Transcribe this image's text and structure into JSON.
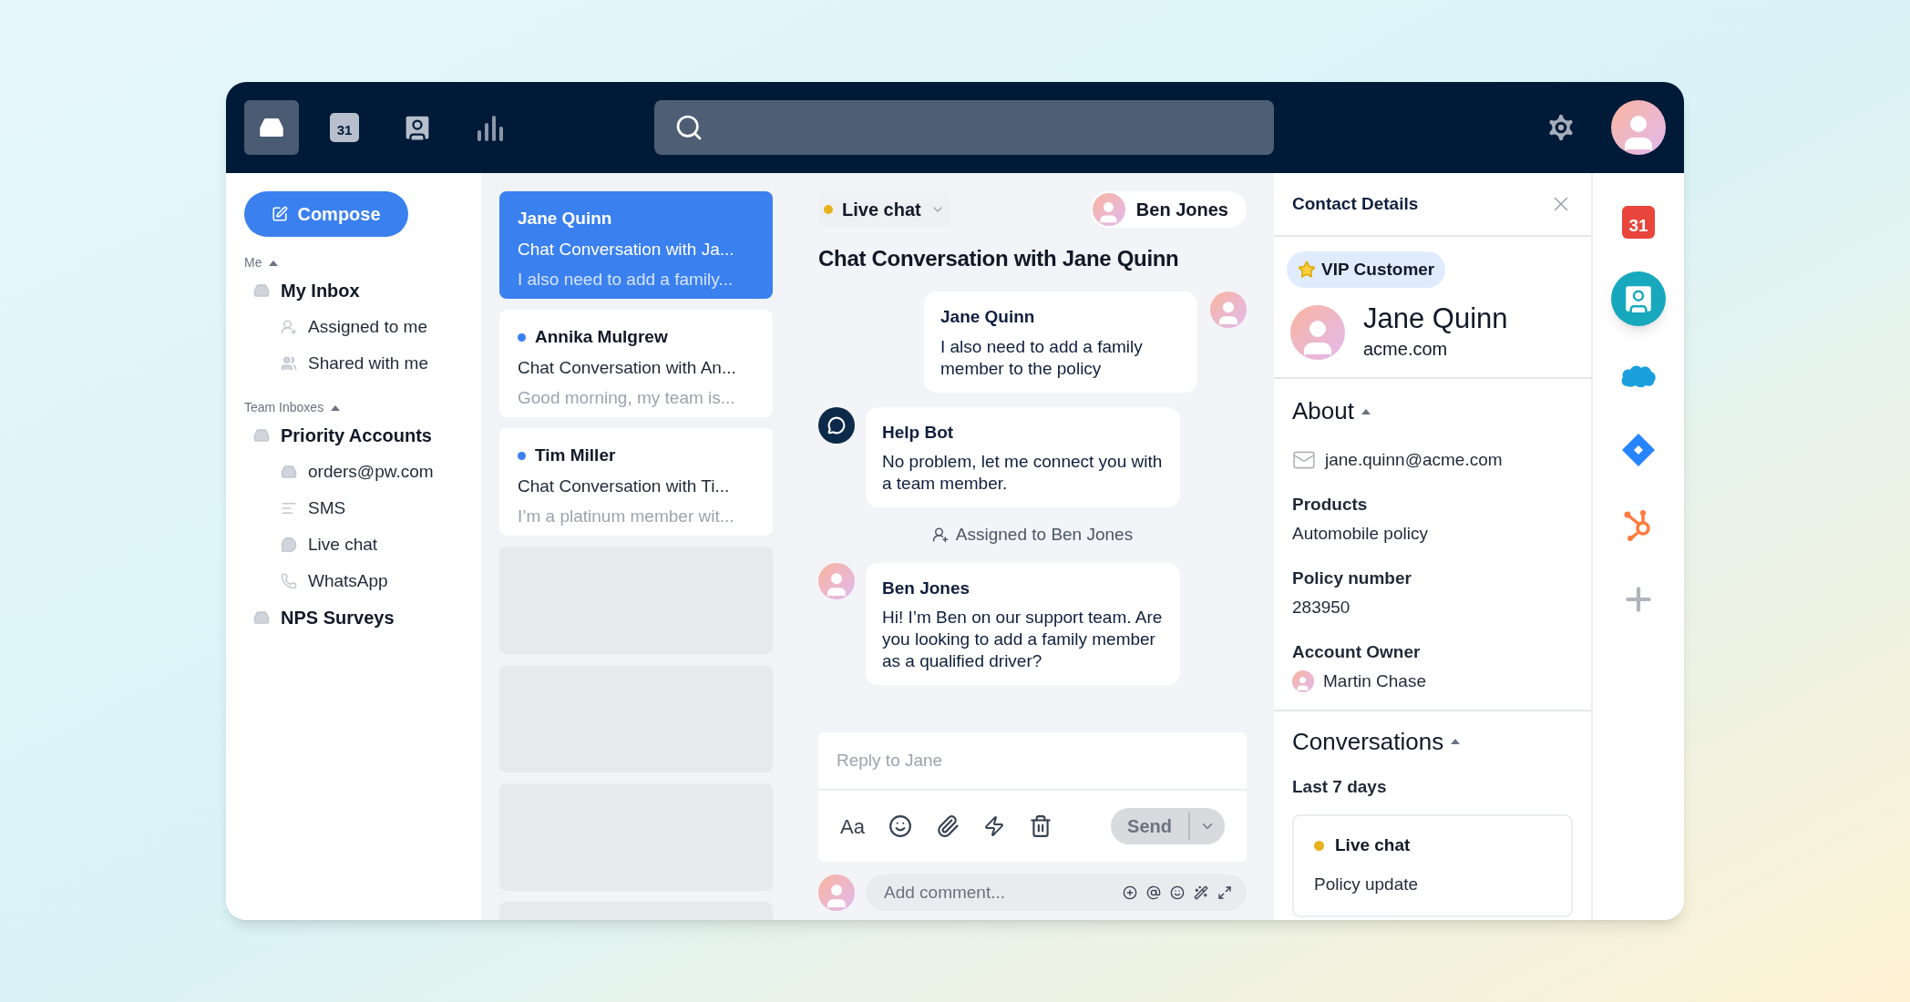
{
  "nav": [
    {
      "kind": "inbox",
      "selected": true
    },
    {
      "kind": "calendar",
      "text": "31",
      "selected": false
    },
    {
      "kind": "contacts",
      "selected": false
    },
    {
      "kind": "reports",
      "selected": false
    }
  ],
  "sidebar": {
    "compose": "Compose",
    "sections": [
      {
        "title": "Me",
        "expanded": true,
        "items": [
          {
            "label": "My Inbox",
            "kind": "inbox",
            "children": [
              {
                "label": "Assigned to me",
                "kind": "assign"
              },
              {
                "label": "Shared with me",
                "kind": "users"
              }
            ]
          }
        ]
      },
      {
        "title": "Team Inboxes",
        "expanded": true,
        "items": [
          {
            "label": "Priority Accounts",
            "kind": "inbox",
            "children": [
              {
                "label": "orders@pw.com",
                "kind": "inbox"
              },
              {
                "label": "SMS",
                "kind": "sms"
              },
              {
                "label": "Live chat",
                "kind": "chat"
              },
              {
                "label": "WhatsApp",
                "kind": "whatsapp"
              }
            ]
          },
          {
            "label": "NPS Surveys",
            "kind": "inbox"
          }
        ]
      }
    ]
  },
  "conversations": [
    {
      "name": "Jane Quinn",
      "subject": "Chat Conversation with Ja...",
      "preview": "I also need to add a family...",
      "selected": true,
      "unread": false
    },
    {
      "name": "Annika Mulgrew",
      "subject": "Chat Conversation with An...",
      "preview": "Good morning, my team is...",
      "selected": false,
      "unread": true
    },
    {
      "name": "Tim Miller",
      "subject": "Chat Conversation with Ti...",
      "preview": "I’m a platinum member wit...",
      "selected": false,
      "unread": true
    }
  ],
  "chat": {
    "channel": {
      "label": "Live chat",
      "color": "#e8b21e"
    },
    "assignee": "Ben Jones",
    "title": "Chat Conversation with Jane Quinn",
    "messages": [
      {
        "kind": "customer",
        "author": "Jane Quinn",
        "text": "I also need to add a family member to the policy"
      },
      {
        "kind": "bot",
        "author": "Help Bot",
        "text": "No problem, let me connect you with a team member."
      },
      {
        "kind": "event",
        "text": "Assigned to Ben Jones"
      },
      {
        "kind": "agent",
        "author": "Ben Jones",
        "text": "Hi! I’m Ben on our support team. Are you looking to add a family member as a qualified driver?"
      }
    ],
    "reply": {
      "placeholder": "Reply to Jane",
      "format": "Aa",
      "send": "Send",
      "disabled": true
    },
    "comment": {
      "placeholder": "Add comment..."
    }
  },
  "contact": {
    "header": "Contact Details",
    "tag": "VIP Customer",
    "name": "Jane Quinn",
    "company": "acme.com",
    "about": {
      "title": "About",
      "expanded": true,
      "email": "jane.quinn@acme.com",
      "fields": [
        {
          "label": "Products",
          "value": "Automobile policy"
        },
        {
          "label": "Policy number",
          "value": "283950"
        }
      ],
      "owner": {
        "label": "Account Owner",
        "value": "Martin Chase"
      }
    },
    "conversations": {
      "title": "Conversations",
      "expanded": true,
      "period": "Last 7 days",
      "items": [
        {
          "channel": "Live chat",
          "color": "#e8b21e",
          "subject": "Policy update"
        }
      ]
    }
  },
  "apps": [
    {
      "kind": "calendar",
      "text": "31",
      "selected": false
    },
    {
      "kind": "contact",
      "selected": true
    },
    {
      "kind": "cloud",
      "selected": false
    },
    {
      "kind": "diamond",
      "selected": false
    },
    {
      "kind": "hub",
      "selected": false
    },
    {
      "kind": "add",
      "selected": false
    }
  ]
}
